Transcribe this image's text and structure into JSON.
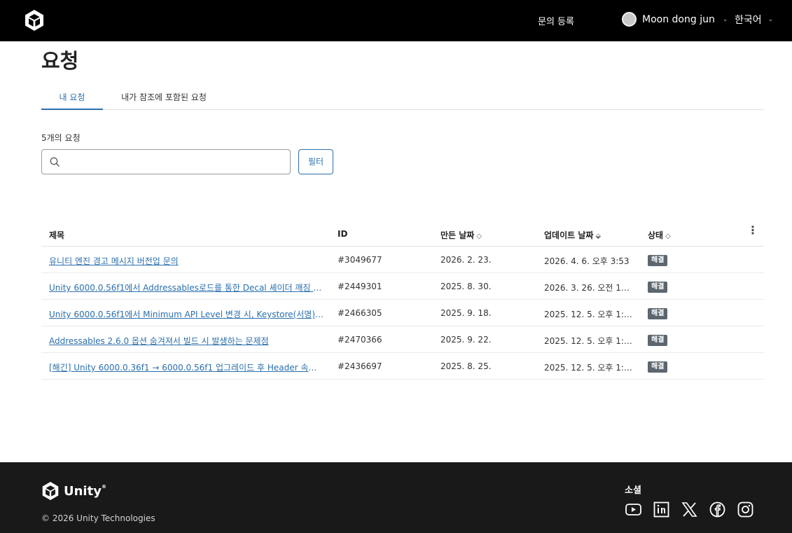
{
  "header": {
    "submit_request": "문의 등록",
    "user_name": "Moon dong jun",
    "user_chevron": "⌄",
    "language": "한국어",
    "language_chevron": "⌄"
  },
  "page": {
    "title": "요청"
  },
  "tabs": [
    {
      "label": "내 요청",
      "active": true
    },
    {
      "label": "내가 참조에 포함된 요청",
      "active": false
    }
  ],
  "requests_count": "5개의 요청",
  "search": {
    "placeholder": "",
    "value": ""
  },
  "filter_label": "필터",
  "table": {
    "columns": {
      "title": "제목",
      "id": "ID",
      "created": "만든 날짜",
      "updated": "업데이트 날짜",
      "status": "상태"
    },
    "sort_indicators": {
      "created": "◇",
      "updated": "⬙",
      "status": "◇"
    },
    "menu_icon": "⋮",
    "rows": [
      {
        "title": "유니티 엔진 경고 메시지 버전업 문의",
        "id": "#3049677",
        "created": "2026. 2. 23.",
        "updated": "2026. 4. 6. 오후 3:53",
        "status": "해결"
      },
      {
        "title": "Unity 6000.0.56f1에서 Addressables로드를 통한 Decal 셰이더 깨짐 이...",
        "id": "#2449301",
        "created": "2025. 8. 30.",
        "updated": "2026. 3. 26. 오전 10:...",
        "status": "해결"
      },
      {
        "title": "Unity 6000.0.56f1에서 Minimum API Level 변경 시, Keystore(서명) ...",
        "id": "#2466305",
        "created": "2025. 9. 18.",
        "updated": "2025. 12. 5. 오후 1:56",
        "status": "해결"
      },
      {
        "title": "Addressables 2.6.0 옵션 숨겨져서 빌드 시 발생하는 문제점",
        "id": "#2470366",
        "created": "2025. 9. 22.",
        "updated": "2025. 12. 5. 오후 1:56",
        "status": "해결"
      },
      {
        "title": "[해긴] Unity 6000.0.36f1 → 6000.0.56f1 업그레이드 후 Header 속성 ...",
        "id": "#2436697",
        "created": "2025. 8. 25.",
        "updated": "2025. 12. 5. 오후 1:56",
        "status": "해결"
      }
    ]
  },
  "footer": {
    "brand": "Unity",
    "brand_reg": "®",
    "copyright": "© 2026 Unity Technologies",
    "social_title": "소셜",
    "social_icons": [
      "youtube-icon",
      "linkedin-icon",
      "x-icon",
      "facebook-icon",
      "instagram-icon"
    ]
  },
  "colors": {
    "header_bg": "#000000",
    "footer_bg": "#191919",
    "accent": "#2b6fad",
    "status_badge": "#5c6670"
  }
}
